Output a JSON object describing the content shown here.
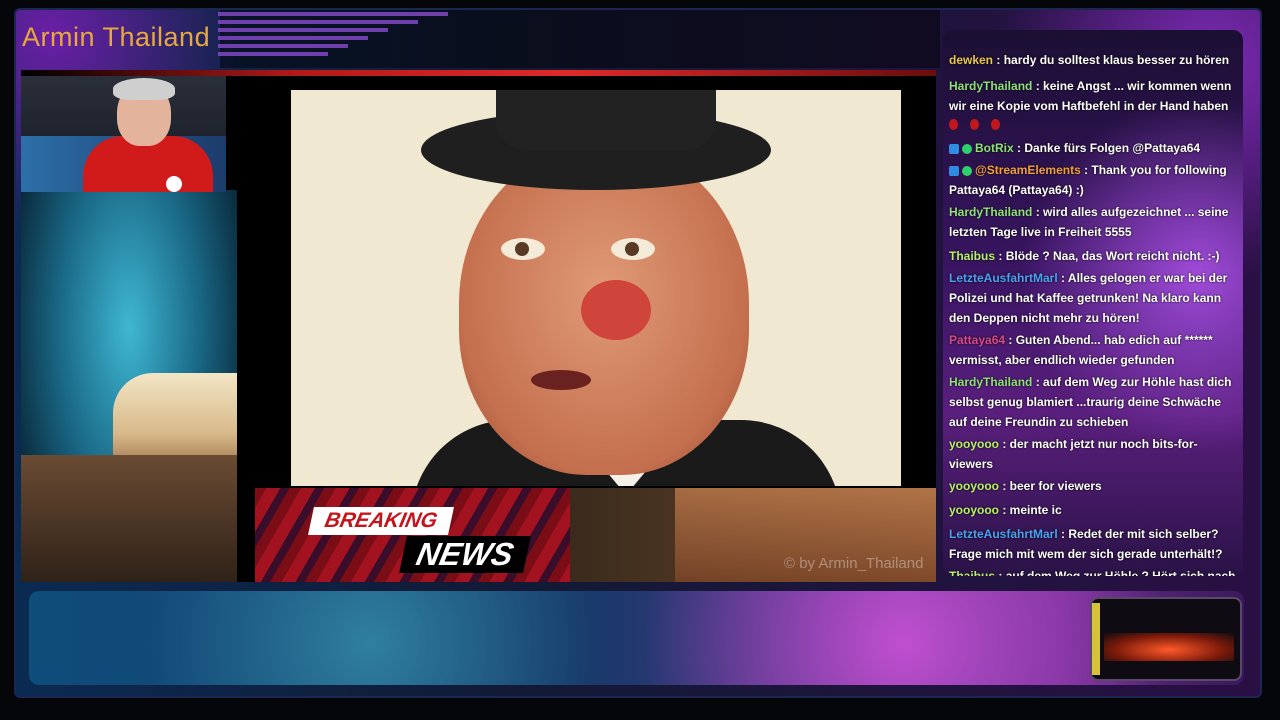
{
  "stream": {
    "channel_name": "Armin Thailand"
  },
  "breaking_news": {
    "line1": "BREAKING",
    "line2": "NEWS"
  },
  "watermark": "© by Armin_Thailand",
  "chat": {
    "messages": [
      {
        "user": "dewken",
        "text": "hardy du solltest klaus besser zu hören",
        "user_color": "#e8c84a"
      },
      {
        "user": "HardyThailand",
        "text": "keine Angst ... wir kommen wenn wir eine Kopie vom Haftbefehl in der Hand haben",
        "user_color": "#8fe07a"
      },
      {
        "user": "",
        "text": "",
        "user_color": "#c0181d"
      },
      {
        "user": "BotRix",
        "text": "Danke fürs Folgen @Pattaya64",
        "user_color": "#8fe07a"
      },
      {
        "user": "@StreamElements",
        "text": "Thank you for following Pattaya64 (Pattaya64) :)",
        "user_color": "#f2a03a"
      },
      {
        "user": "HardyThailand",
        "text": "wird alles aufgezeichnet ... seine letzten Tage live in Freiheit 5555",
        "user_color": "#8fe07a"
      },
      {
        "user": "Thaibus",
        "text": "Blöde ? Naa, das Wort reicht nicht. :-)",
        "user_color": "#b8f06a"
      },
      {
        "user": "LetzteAusfahrtMarl",
        "text": "Alles gelogen er war bei der Polizei und hat Kaffee getrunken! Na klaro kann den Deppen nicht mehr zu hören!",
        "user_color": "#4aa3f2"
      },
      {
        "user": "Pattaya64",
        "text": "Guten Abend... hab edich auf ****** vermisst, aber endlich wieder gefunden",
        "user_color": "#d94a8a"
      },
      {
        "user": "HardyThailand",
        "text": "auf dem Weg zur Höhle hast dich selbst genug blamiert ...traurig deine Schwäche auf deine Freundin zu schieben",
        "user_color": "#8fe07a"
      },
      {
        "user": "yooyooo",
        "text": "der macht jetzt nur noch bits-for-viewers",
        "user_color": "#b8f06a"
      },
      {
        "user": "yooyooo",
        "text": "beer for viewers",
        "user_color": "#b8f06a"
      },
      {
        "user": "yooyooo",
        "text": "meinte ic",
        "user_color": "#b8f06a"
      },
      {
        "user": "LetzteAusfahrtMarl",
        "text": "Redet der mit sich selber? Frage mich mit wem der sich gerade unterhält!?",
        "user_color": "#4aa3f2"
      },
      {
        "user": "Thaibus",
        "text": "auf dem Weg zur Höhle ? Hört sich nach Flucht - winter - quartier an... grins.",
        "user_color": "#b8f06a"
      }
    ]
  },
  "colors": {
    "channel_title": "#e8a93b",
    "breaking_red": "#c4141c"
  }
}
